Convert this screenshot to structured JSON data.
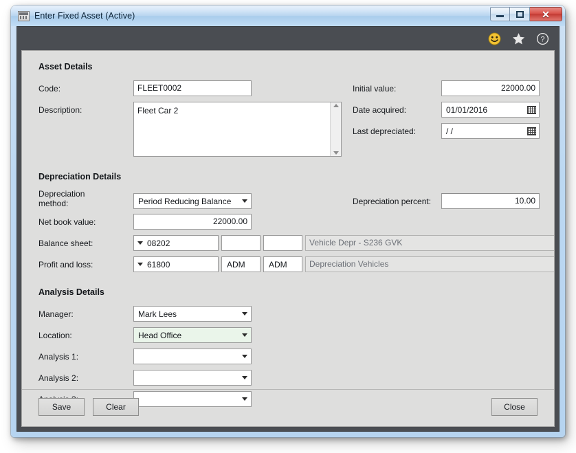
{
  "window": {
    "title": "Enter Fixed Asset (Active)",
    "app_icon": "form-window-icon",
    "controls": {
      "minimize": "minimize-button",
      "maximize": "maximize-button",
      "close": "✕"
    }
  },
  "toolbar": {
    "icons": [
      {
        "name": "smiley-feedback-icon",
        "glyph": "☺",
        "color": "#f2c233"
      },
      {
        "name": "favourite-star-icon",
        "glyph": "★",
        "color": "#e8e8e8"
      },
      {
        "name": "help-question-icon",
        "glyph": "?",
        "color": "#e8e8e8"
      }
    ]
  },
  "sections": {
    "asset": {
      "title": "Asset Details",
      "code_label": "Code:",
      "code_value": "FLEET0002",
      "description_label": "Description:",
      "description_value": "Fleet Car 2",
      "initial_value_label": "Initial value:",
      "initial_value": "22000.00",
      "date_acquired_label": "Date acquired:",
      "date_acquired": "01/01/2016",
      "last_depreciated_label": "Last depreciated:",
      "last_depreciated": "/ /"
    },
    "depreciation": {
      "title": "Depreciation Details",
      "method_label": "Depreciation method:",
      "method_value": "Period Reducing Balance",
      "percent_label": "Depreciation percent:",
      "percent_value": "10.00",
      "nbv_label": "Net book value:",
      "nbv_value": "22000.00",
      "balance_sheet_label": "Balance sheet:",
      "balance_sheet_account": "08202",
      "balance_sheet_c2": "",
      "balance_sheet_c3": "",
      "balance_sheet_desc": "Vehicle Depr - S236 GVK",
      "profit_loss_label": "Profit and loss:",
      "profit_loss_account": "61800",
      "profit_loss_c2": "ADM",
      "profit_loss_c3": "ADM",
      "profit_loss_desc": "Depreciation Vehicles"
    },
    "analysis": {
      "title": "Analysis Details",
      "manager_label": "Manager:",
      "manager_value": "Mark Lees",
      "location_label": "Location:",
      "location_value": "Head Office",
      "analysis1_label": "Analysis 1:",
      "analysis1_value": "",
      "analysis2_label": "Analysis 2:",
      "analysis2_value": "",
      "analysis3_label": "Analysis 3:",
      "analysis3_value": ""
    }
  },
  "buttons": {
    "save": "Save",
    "clear": "Clear",
    "close": "Close"
  },
  "colors": {
    "titlebar_blue": "#b8d5f0",
    "toolbar_dark": "#4a4d52",
    "panel_gray": "#dededd",
    "close_red": "#d9534b",
    "highlight_green": "#eaf5ea"
  }
}
